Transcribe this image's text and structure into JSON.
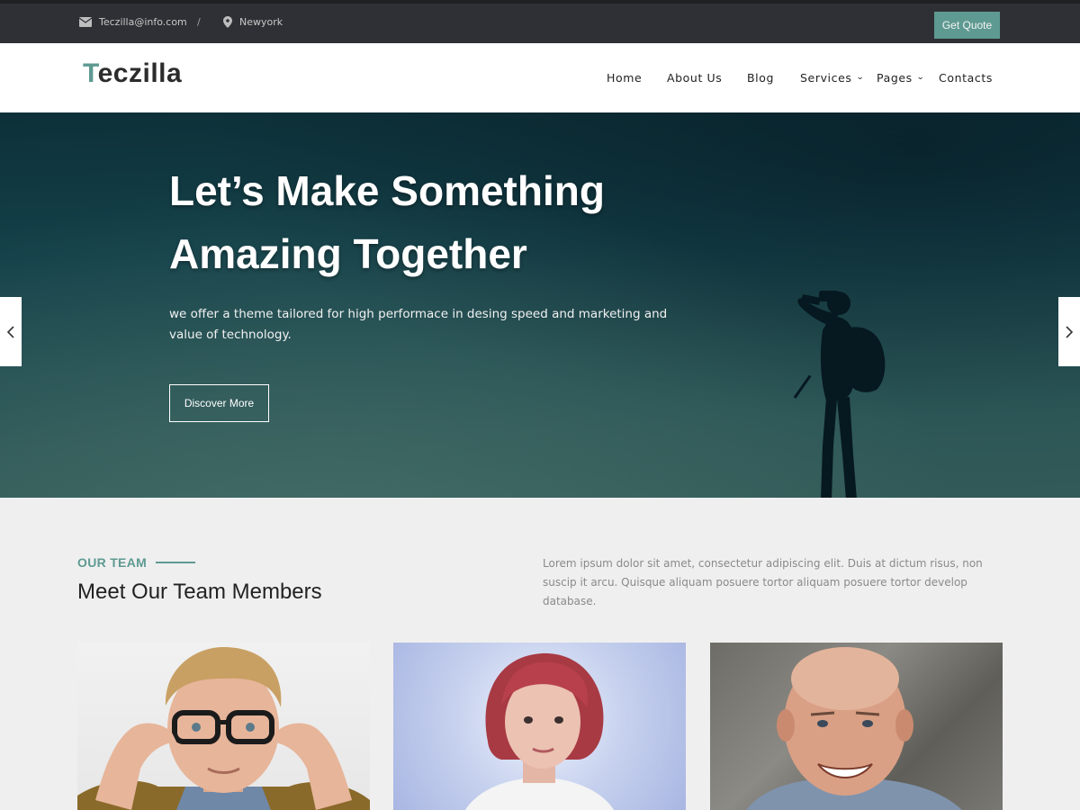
{
  "topbar": {
    "email": "Teczilla@info.com",
    "separator": "/",
    "location": "Newyork",
    "quote_button": "Get Quote"
  },
  "header": {
    "logo_first_letter": "T",
    "logo_rest": "eczilla",
    "nav": [
      {
        "label": "Home"
      },
      {
        "label": "About Us"
      },
      {
        "label": "Blog"
      },
      {
        "label": "Services"
      },
      {
        "label": "Pages"
      },
      {
        "label": "Contacts"
      }
    ]
  },
  "hero": {
    "title_line1": "Let’s Make Something",
    "title_line2": "Amazing Together",
    "subtitle": "we offer a theme tailored for high performace in desing speed and marketing and value of technology.",
    "button": "Discover More"
  },
  "team": {
    "eyebrow": "OUR TEAM",
    "heading": "Meet Our Team Members",
    "description": "Lorem ipsum dolor sit amet, consectetur adipiscing elit. Duis at dictum risus, non suscip it arcu. Quisque aliquam posuere tortor aliquam posuere tortor develop database."
  },
  "colors": {
    "accent": "#5e9a92",
    "topbar_bg": "#2f3035"
  },
  "icons": [
    "envelope-icon",
    "map-pin-icon",
    "chevron-down-icon",
    "chevron-left-icon",
    "chevron-right-icon"
  ]
}
